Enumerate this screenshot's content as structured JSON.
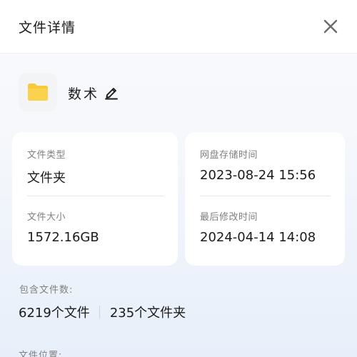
{
  "header": {
    "title": "文件详情"
  },
  "folder": {
    "name": "数术"
  },
  "details": {
    "file_type_label": "文件类型",
    "file_type_value": "文件夹",
    "file_size_label": "文件大小",
    "file_size_value": "1572.16GB",
    "stored_time_label": "网盘存储时间",
    "stored_time_value": "2023-08-24 15:56",
    "modified_time_label": "最后修改时间",
    "modified_time_value": "2024-04-14 14:08"
  },
  "contains": {
    "label": "包含文件数:",
    "files": "6219个文件",
    "folders": "235个文件夹"
  },
  "location": {
    "label": "文件位置:"
  },
  "colors": {
    "folder_yellow": "#f9c93d",
    "label_gray": "#808080",
    "text_dark": "#1b1b1b"
  }
}
